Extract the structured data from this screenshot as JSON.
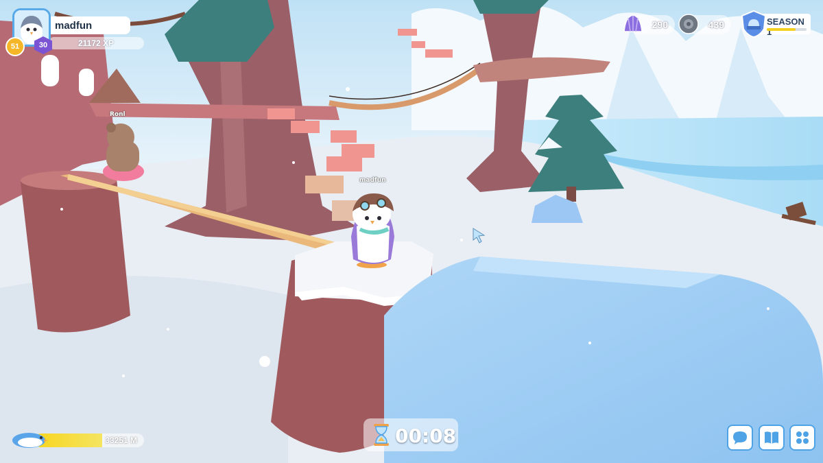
{
  "player": {
    "name": "madfun",
    "xp_text": "21172 XP",
    "level": "51",
    "rank": "30"
  },
  "currencies": [
    {
      "icon": "shell-icon",
      "value": "290",
      "color": "#8b6fe0"
    },
    {
      "icon": "stone-coin-icon",
      "value": "439",
      "color": "#6e7682"
    }
  ],
  "season": {
    "label": "SEASON 1",
    "progress": 0.72
  },
  "world_labels": {
    "other_player": "Ronl",
    "local_player": "madfun"
  },
  "distance": {
    "value_text": "33251 M",
    "fill": 0.62
  },
  "timer": {
    "value": "00:08"
  },
  "buttons": [
    {
      "name": "chat-button",
      "icon": "chat-icon"
    },
    {
      "name": "guide-button",
      "icon": "book-icon"
    },
    {
      "name": "menu-button",
      "icon": "grid-menu-icon"
    }
  ],
  "colors": {
    "accent": "#4ea3e6",
    "xp_gold": "#f5b728",
    "rank_purple": "#7b54d4",
    "distance_yellow": "#f8d51e"
  }
}
